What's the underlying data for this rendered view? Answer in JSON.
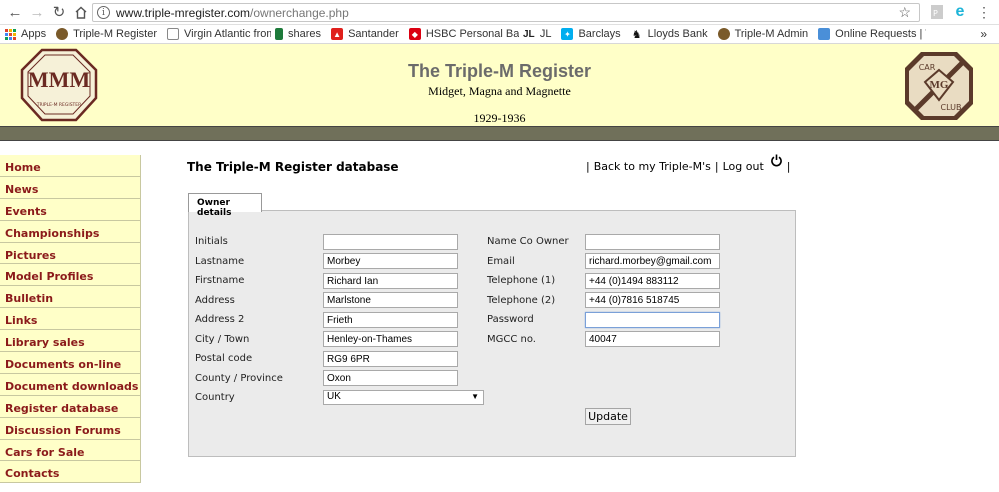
{
  "browser": {
    "url_domain": "www.triple-mregister.com",
    "url_path": "/ownerchange.php",
    "bookmarks": [
      {
        "label": "Apps",
        "icon": "apps-grid-icon",
        "color": "#e0452b"
      },
      {
        "label": "Triple-M Register",
        "icon": "mg-octagon-icon",
        "color": "#7a5a2a"
      },
      {
        "label": "Virgin Atlantic from M",
        "icon": "page-icon",
        "color": "#888888"
      },
      {
        "label": "shares",
        "icon": "green-square-icon",
        "color": "#1d7a3a"
      },
      {
        "label": "Santander",
        "icon": "santander-flame-icon",
        "color": "#e0201c"
      },
      {
        "label": "HSBC Personal Bankir",
        "icon": "hsbc-hex-icon",
        "color": "#db0011"
      },
      {
        "label": "JL",
        "icon": "jl-icon",
        "color": "#222222"
      },
      {
        "label": "Barclays",
        "icon": "barclays-eagle-icon",
        "color": "#00aeef"
      },
      {
        "label": "Lloyds Bank",
        "icon": "lloyds-horse-icon",
        "color": "#111111"
      },
      {
        "label": "Triple-M Admin",
        "icon": "mg-octagon-icon",
        "color": "#7a5a2a"
      },
      {
        "label": "Online Requests | Th",
        "icon": "page-icon",
        "color": "#4a8fd8"
      }
    ]
  },
  "header": {
    "title": "The Triple-M Register",
    "subtitle": "Midget, Magna and Magnette",
    "years": "1929-1936",
    "logo_left_text": "TRIPLE-M REGISTER",
    "logo_right_top": "CAR",
    "logo_right_bottom": "CLUB"
  },
  "sidebar": {
    "items": [
      "Home",
      "News",
      "Events",
      "Championships",
      "Pictures",
      "Model Profiles",
      "Bulletin",
      "Links",
      "Library sales",
      "Documents on-line",
      "Document downloads",
      "Register database",
      "Discussion Forums",
      "Cars for Sale",
      "Contacts"
    ]
  },
  "main": {
    "heading": "The Triple-M Register database",
    "back_link": "Back to my Triple-M's",
    "logout_link": "Log out",
    "tab_label": "Owner details",
    "left_fields": [
      {
        "label": "Initials",
        "value": ""
      },
      {
        "label": "Lastname",
        "value": "Morbey"
      },
      {
        "label": "Firstname",
        "value": "Richard Ian"
      },
      {
        "label": "Address",
        "value": "Marlstone"
      },
      {
        "label": "Address 2",
        "value": "Frieth"
      },
      {
        "label": "City / Town",
        "value": "Henley-on-Thames"
      },
      {
        "label": "Postal code",
        "value": "RG9 6PR"
      },
      {
        "label": "County / Province",
        "value": "Oxon"
      }
    ],
    "country_label": "Country",
    "country_value": "UK",
    "right_fields": [
      {
        "label": "Name Co Owner",
        "value": ""
      },
      {
        "label": "Email",
        "value": "richard.morbey@gmail.com"
      },
      {
        "label": "Telephone (1)",
        "value": "+44 (0)1494 883112"
      },
      {
        "label": "Telephone (2)",
        "value": "+44 (0)7816 518745"
      },
      {
        "label": "Password",
        "value": ""
      },
      {
        "label": "MGCC no.",
        "value": "40047"
      }
    ],
    "update_label": "Update"
  },
  "colors": {
    "header_bg": "#ffffc8",
    "band": "#70705a",
    "menu_text": "#8b1a1a",
    "panel_bg": "#ebebeb"
  }
}
